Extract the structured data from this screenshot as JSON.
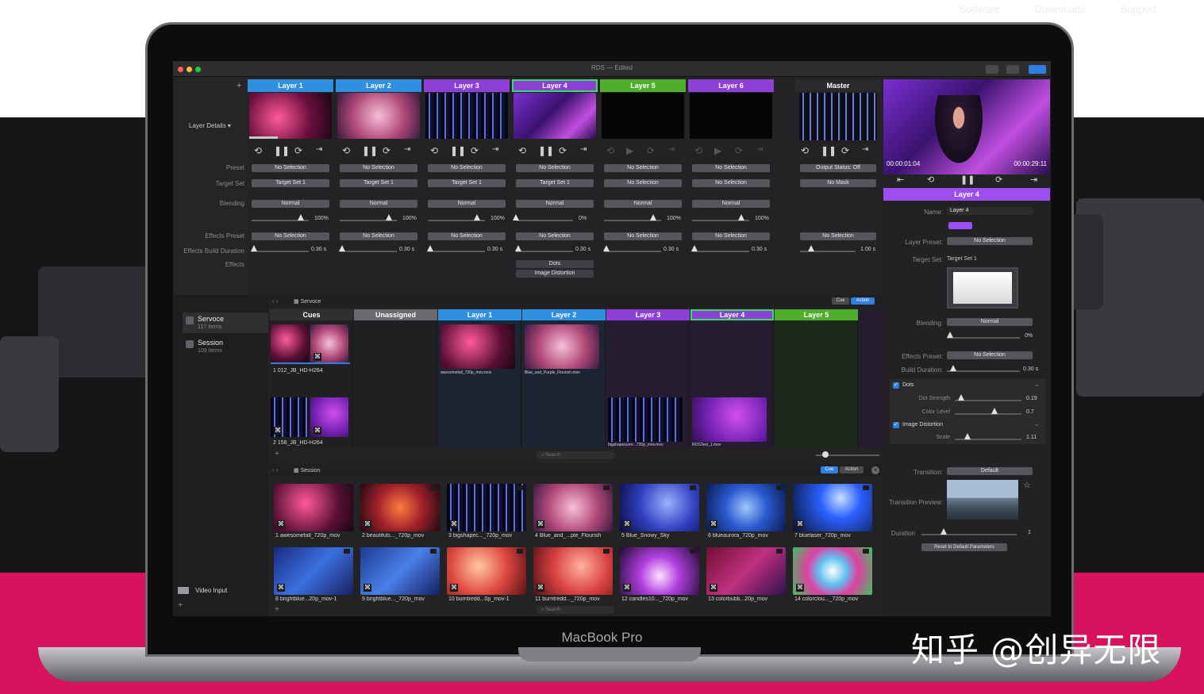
{
  "top_nav": [
    "Software",
    "Downloads",
    "Support"
  ],
  "device_brand": "MacBook Pro",
  "watermark": "知乎 @创异无限",
  "window": {
    "title": "RDS — Edited"
  },
  "layer_details": {
    "header": "Layer Details",
    "row_labels": {
      "preset": "Preset",
      "target_set": "Target Set",
      "blending": "Blending",
      "effects_preset": "Effects Preset",
      "effects_build_duration": "Effects Build Duration",
      "effects": "Effects"
    },
    "columns": [
      {
        "name": "Layer 1",
        "color": "#2f8fe0",
        "preset": "No Selection",
        "target_set": "Target Set 1",
        "blending": "Normal",
        "opacity": "100%",
        "effects_preset": "No Selection",
        "duration": "0.30 s"
      },
      {
        "name": "Layer 2",
        "color": "#2f8fe0",
        "preset": "No Selection",
        "target_set": "Target Set 1",
        "blending": "Normal",
        "opacity": "100%",
        "effects_preset": "No Selection",
        "duration": "0.30 s"
      },
      {
        "name": "Layer 3",
        "color": "#8e3fd6",
        "preset": "No Selection",
        "target_set": "Target Set 1",
        "blending": "Normal",
        "opacity": "100%",
        "effects_preset": "No Selection",
        "duration": "0.30 s"
      },
      {
        "name": "Layer 4",
        "color": "#8e3fd6",
        "preset": "No Selection",
        "target_set": "Target Set 1",
        "blending": "Normal",
        "opacity": "0%",
        "effects_preset": "No Selection",
        "duration": "0.30 s",
        "effects": [
          "Dots",
          "Image Distortion"
        ]
      },
      {
        "name": "Layer 5",
        "color": "#4fae2c",
        "preset": "No Selection",
        "target_set": "No Selection",
        "blending": "Normal",
        "opacity": "100%",
        "effects_preset": "No Selection",
        "duration": "0.30 s"
      },
      {
        "name": "Layer 6",
        "color": "#8e3fd6",
        "preset": "No Selection",
        "target_set": "No Selection",
        "blending": "Normal",
        "opacity": "100%",
        "effects_preset": "No Selection",
        "duration": "0.30 s"
      }
    ],
    "master": {
      "name": "Master",
      "status": "Output Status: Off",
      "mask": "No Mask",
      "effects_preset": "No Selection",
      "duration": "1.00 s"
    }
  },
  "preview": {
    "time_elapsed": "00:00:01:04",
    "time_remaining": "00:00:29:11",
    "layer_label": "Layer 4"
  },
  "inspector": {
    "name_label": "Name:",
    "name_value": "Layer 4",
    "layer_preset_label": "Layer Preset:",
    "layer_preset_value": "No Selection",
    "target_set_label": "Target Set:",
    "target_set_value": "Target Set 1",
    "blending_label": "Blending:",
    "blending_value": "Normal",
    "opacity": "0%",
    "effects_preset_label": "Effects Preset:",
    "effects_preset_value": "No Selection",
    "build_duration_label": "Build Duration:",
    "build_duration_value": "0.30 s",
    "effect_dots": "Dots",
    "dot_strength_label": "Dot Strength",
    "dot_strength_value": "0.19",
    "color_level_label": "Color Level",
    "color_level_value": "0.7",
    "effect_distortion": "Image Distortion",
    "scale_label": "Scale",
    "scale_value": "1.11",
    "transition_label": "Transition:",
    "transition_value": "Default",
    "transition_preview_label": "Transition Preview:",
    "duration_label": "Duration",
    "duration_value": "1",
    "reset_button": "Reset to Default Parameters"
  },
  "sidebar": {
    "items": [
      {
        "name": "Servoce",
        "count": "117 Items"
      },
      {
        "name": "Session",
        "count": "109 Items"
      }
    ],
    "video_input": "Video Input"
  },
  "cue_panel": {
    "breadcrumb": "Servoce",
    "cue_btn": "Cue",
    "action_btn": "Action",
    "columns": [
      {
        "name": "Cues",
        "color": "#303033"
      },
      {
        "name": "Unassigned",
        "color": "#6a6a6e"
      },
      {
        "name": "Layer 1",
        "color": "#2f8fe0"
      },
      {
        "name": "Layer 2",
        "color": "#2f8fe0"
      },
      {
        "name": "Layer 3",
        "color": "#8e3fd6"
      },
      {
        "name": "Layer 4",
        "color": "#8e3fd6"
      },
      {
        "name": "Layer 5",
        "color": "#4fae2c"
      }
    ],
    "cues": [
      "1  012_JB_HD-H264",
      "2  158_JB_HD-H264"
    ],
    "layer_clips": [
      "awesomefall_720p_mov.mov",
      "Blue_and_Purple_Flourish.mov",
      "bigshapesurre...720p_mov.mov",
      "ROSTest_1.mov"
    ],
    "search_placeholder": "Search"
  },
  "session_panel": {
    "breadcrumb": "Session",
    "cue_btn": "Cue",
    "action_btn": "Action",
    "clips": [
      "1  awesomefall_720p_mov",
      "2  beautifuls..._720p_mov",
      "3  bigshapec..._720p_mov",
      "4  Blue_and_...ple_Flourish",
      "5  Blue_Snowy_Sky",
      "6  blueaurora_720p_mov",
      "7  bluelaser_720p_mov",
      "8  brightblue...20p_mov-1",
      "9  brightblue..._720p_mov",
      "10  burntredd...0p_mov-1",
      "11  burntredd..._720p_mov",
      "12  candles10..._720p_mov",
      "13  colorbubb...20p_mov",
      "14  colorclou..._720p_mov"
    ],
    "search_placeholder": "Search"
  }
}
